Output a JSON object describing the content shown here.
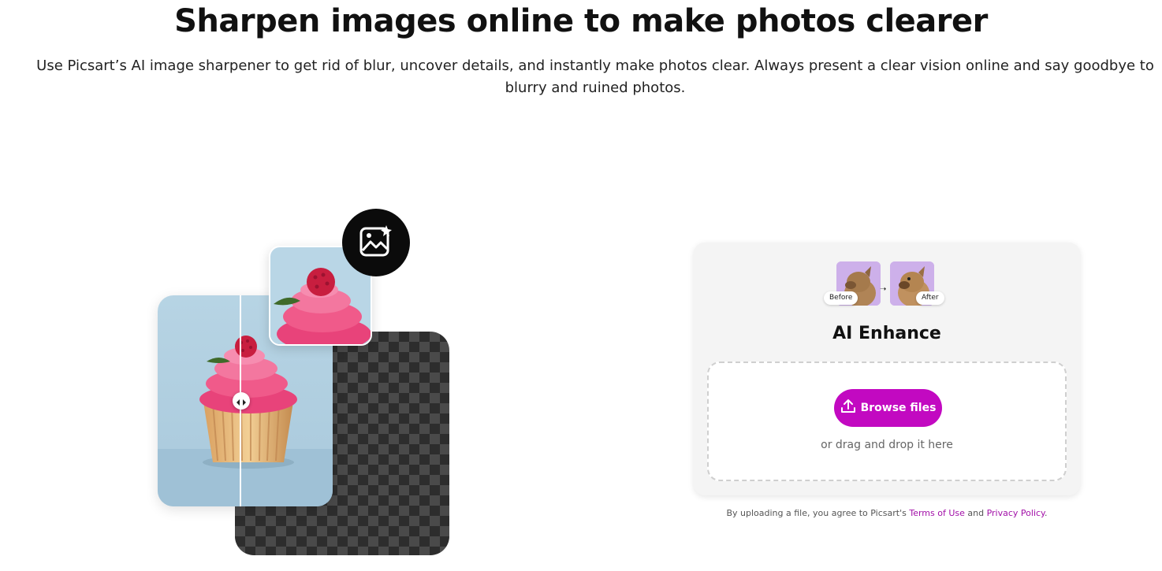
{
  "hero": {
    "title": "Sharpen images online to make photos clearer",
    "subtitle": "Use Picsart’s AI image sharpener to get rid of blur, uncover details, and instantly make photos clear. Always present a clear vision online and say goodbye to blurry and ruined photos."
  },
  "illustration": {
    "badge_icon": "image-sparkle-icon",
    "slider_icon": "compare-arrows-icon"
  },
  "uploader": {
    "before_label": "Before",
    "after_label": "After",
    "title": "AI Enhance",
    "browse_label": "Browse files",
    "browse_icon": "upload-icon",
    "drop_hint": "or drag and drop it here",
    "accent_color": "#c209c1"
  },
  "legal": {
    "prefix": "By uploading a file, you agree to Picsart's",
    "terms_label": "Terms of Use",
    "and_text": "and",
    "privacy_label": "Privacy Policy",
    "suffix": "."
  }
}
